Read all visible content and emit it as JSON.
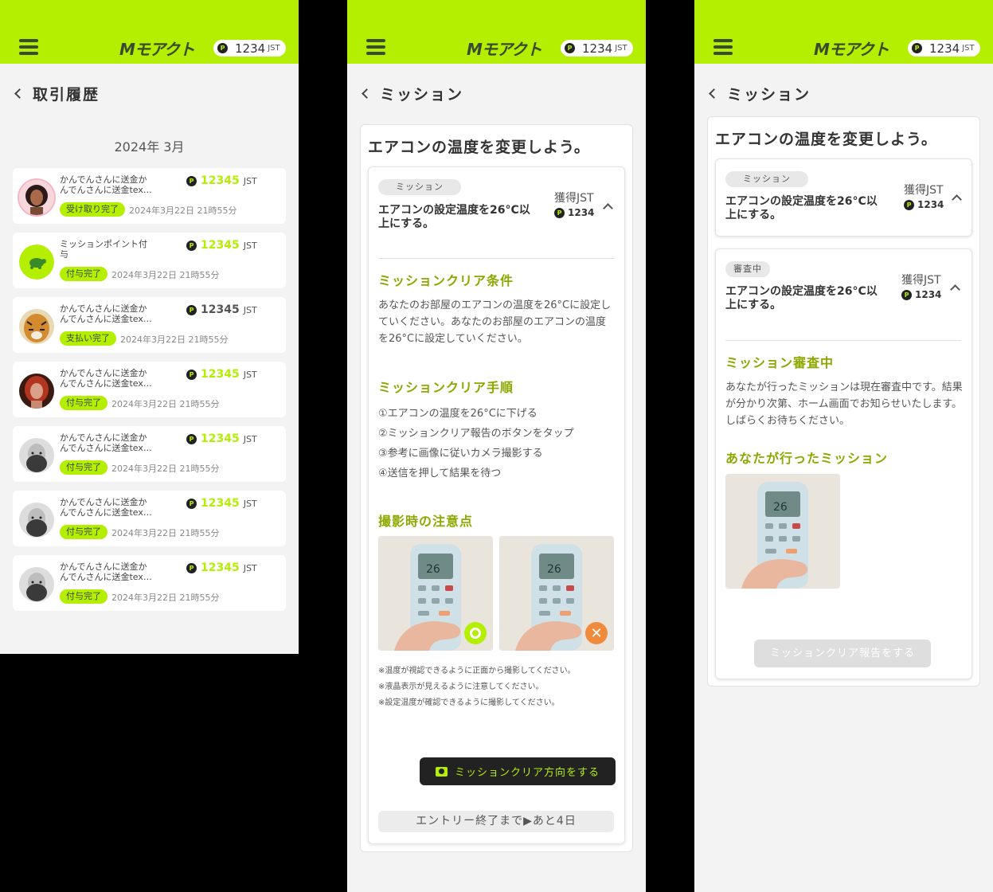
{
  "header": {
    "logo": "Mモアクト",
    "points": "1234",
    "points_unit": "JST",
    "coin_letter": "P"
  },
  "history": {
    "title": "取引履歴",
    "month": "2024年 3月",
    "items": [
      {
        "desc": "かんでんさんに送金かんでんさんに送金tex…",
        "amount": "12345",
        "unit": "JST",
        "badge": "受け取り完了",
        "date": "2024年3月22日 21時55分"
      },
      {
        "desc": "ミッションポイント付与",
        "amount": "12345",
        "unit": "JST",
        "badge": "付与完了",
        "date": "2024年3月22日 21時55分"
      },
      {
        "desc": "かんでんさんに送金かんでんさんに送金tex…",
        "amount": "12345",
        "unit": "JST",
        "badge": "支払い完了",
        "date": "2024年3月22日 21時55分"
      },
      {
        "desc": "かんでんさんに送金かんでんさんに送金tex…",
        "amount": "12345",
        "unit": "JST",
        "badge": "付与完了",
        "date": "2024年3月22日 21時55分"
      },
      {
        "desc": "かんでんさんに送金かんでんさんに送金tex…",
        "amount": "12345",
        "unit": "JST",
        "badge": "付与完了",
        "date": "2024年3月22日 21時55分"
      },
      {
        "desc": "かんでんさんに送金かんでんさんに送金tex…",
        "amount": "12345",
        "unit": "JST",
        "badge": "付与完了",
        "date": "2024年3月22日 21時55分"
      },
      {
        "desc": "かんでんさんに送金かんでんさんに送金tex…",
        "amount": "12345",
        "unit": "JST",
        "badge": "付与完了",
        "date": "2024年3月22日 21時55分"
      }
    ]
  },
  "mission_detail": {
    "page_title": "ミッション",
    "title": "エアコンの温度を変更しよう。",
    "chip": "ミッション",
    "desc": "エアコンの設定温度を26°C以上にする。",
    "reward_label": "獲得JST",
    "reward_value": "1234",
    "cond_heading": "ミッションクリア条件",
    "cond_text": "あなたのお部屋のエアコンの温度を26°Cに設定していください。あなたのお部屋のエアコンの温度を26°Cに設定していください。",
    "steps_heading": "ミッションクリア手順",
    "steps": [
      "①エアコンの温度を26°Cに下げる",
      "②ミッションクリア報告のボタンをタップ",
      "③参考に画像に従いカメラ撮影する",
      "④送信を押して結果を待つ"
    ],
    "notes_heading": "撮影時の注意点",
    "notes": [
      "※温度が視認できるように正面から撮影してください。",
      "※液晶表示が見えるように注意してください。",
      "※設定温度が確認できるように撮影してください。"
    ],
    "camera_button": "ミッションクリア方向をする",
    "deadline": "エントリー終了まで▶あと4日"
  },
  "mission_review": {
    "page_title": "ミッション",
    "title": "エアコンの温度を変更しよう。",
    "card1": {
      "chip": "ミッション",
      "desc": "エアコンの設定温度を26°C以上にする。",
      "reward_label": "獲得JST",
      "reward_value": "1234"
    },
    "card2": {
      "chip": "審査中",
      "desc": "エアコンの設定温度を26°C以上にする。",
      "reward_label": "獲得JST",
      "reward_value": "1234"
    },
    "review_heading": "ミッション審査中",
    "review_text": "あなたが行ったミッションは現在審査中です。結果が分かり次第、ホーム画面でお知らせいたします。しばらくお待ちください。",
    "your_mission_heading": "あなたが行ったミッション",
    "report_button": "ミッションクリア報告をする"
  },
  "colors": {
    "accent": "#b4ee00",
    "dark": "#222222",
    "heading_green": "#8da800",
    "ng_orange": "#f08a3c"
  }
}
